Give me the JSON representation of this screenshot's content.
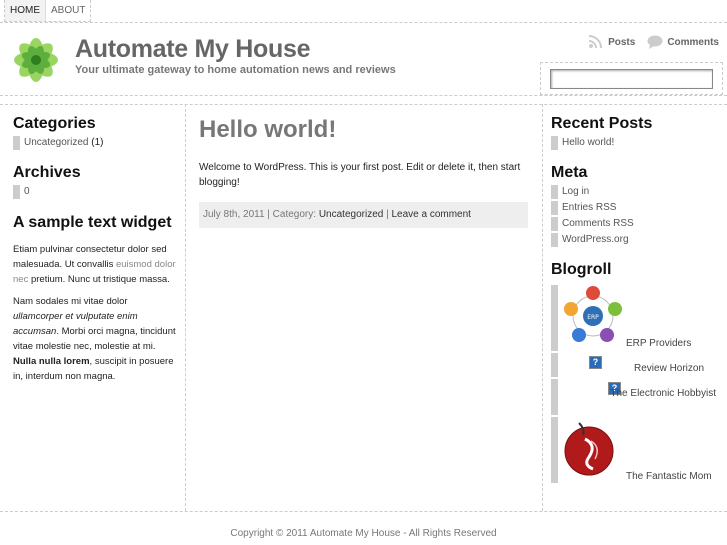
{
  "nav": {
    "home": "HOME",
    "about": "ABOUT"
  },
  "header": {
    "title": "Automate My House",
    "tagline": "Your ultimate gateway to home automation news and reviews",
    "posts_feed": "Posts",
    "comments_feed": "Comments",
    "search_value": ""
  },
  "left": {
    "categories_title": "Categories",
    "categories": [
      {
        "label": "Uncategorized",
        "count": "(1)"
      }
    ],
    "archives_title": "Archives",
    "archives_item": "0",
    "text_widget_title": "A sample text widget",
    "para1": {
      "a": "Etiam pulvinar consectetur dolor sed malesuada. Ut convallis ",
      "b": "euismod dolor nec",
      "c": " pretium. Nunc ut tristique massa."
    },
    "para2": {
      "a": "Nam sodales mi vitae dolor ",
      "b": "ullamcorper et vulputate enim accumsan",
      "c": ". Morbi orci magna, tincidunt vitae molestie nec, molestie at mi. ",
      "d": "Nulla nulla lorem",
      "e": ", suscipit in posuere in, interdum non magna."
    }
  },
  "post": {
    "title": "Hello world!",
    "body": "Welcome to WordPress. This is your first post. Edit or delete it, then start blogging!",
    "date": "July 8th, 2011",
    "sep1": " | Category: ",
    "category": "Uncategorized",
    "sep2": " | ",
    "comment_link": "Leave a comment"
  },
  "right": {
    "recent_title": "Recent Posts",
    "recent_item": "Hello world!",
    "meta_title": "Meta",
    "meta_items": [
      "Log in",
      "Entries RSS",
      "Comments RSS",
      "WordPress.org"
    ],
    "blogroll_title": "Blogroll",
    "blogroll": [
      "ERP Providers",
      "Review Horizon",
      "The Electronic Hobbyist",
      "The Fantastic Mom"
    ],
    "erp_badge": "ERP",
    "missing_image": "?"
  },
  "footer": {
    "copyright": "Copyright © 2011 Automate My House - All Rights Reserved"
  },
  "colors": {
    "logo_green": "#7cc242",
    "logo_dark": "#3c8f2a",
    "bar": "#cccccc",
    "title_gray": "#666666"
  }
}
